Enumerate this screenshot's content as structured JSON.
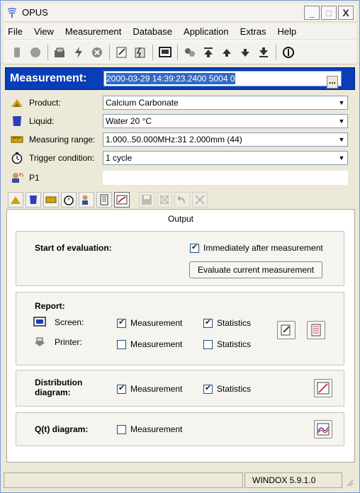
{
  "window": {
    "title": "OPUS",
    "minimize": "_",
    "maximize": "□",
    "close": "X"
  },
  "menu": [
    "File",
    "View",
    "Measurement",
    "Database",
    "Application",
    "Extras",
    "Help"
  ],
  "measurement": {
    "label": "Measurement:",
    "value": "2000-03-29 14:39:23.2400 5004 0",
    "browse": "..."
  },
  "params": {
    "product_label": "Product:",
    "product_value": "Calcium Carbonate",
    "liquid_label": "Liquid:",
    "liquid_value": "Water 20 °C",
    "range_label": "Measuring range:",
    "range_value": "1.000..50.000MHz:31 2.000mm (44)",
    "trigger_label": "Trigger condition:",
    "trigger_value": "1 cycle",
    "p1_label": "P1"
  },
  "output": {
    "title": "Output",
    "start_eval_header": "Start of evaluation:",
    "immediately_label": "Immediately after measurement",
    "immediately_checked": true,
    "evaluate_button": "Evaluate current measurement",
    "report_header": "Report:",
    "screen_label": "Screen:",
    "printer_label": "Printer:",
    "measurement_label": "Measurement",
    "statistics_label": "Statistics",
    "screen_measurement_checked": true,
    "screen_statistics_checked": true,
    "printer_measurement_checked": false,
    "printer_statistics_checked": false,
    "distribution_header": "Distribution diagram:",
    "dist_measurement_checked": true,
    "dist_statistics_checked": true,
    "qt_header": "Q(t) diagram:",
    "qt_measurement_checked": false
  },
  "status": {
    "version": "WINDOX 5.9.1.0"
  }
}
